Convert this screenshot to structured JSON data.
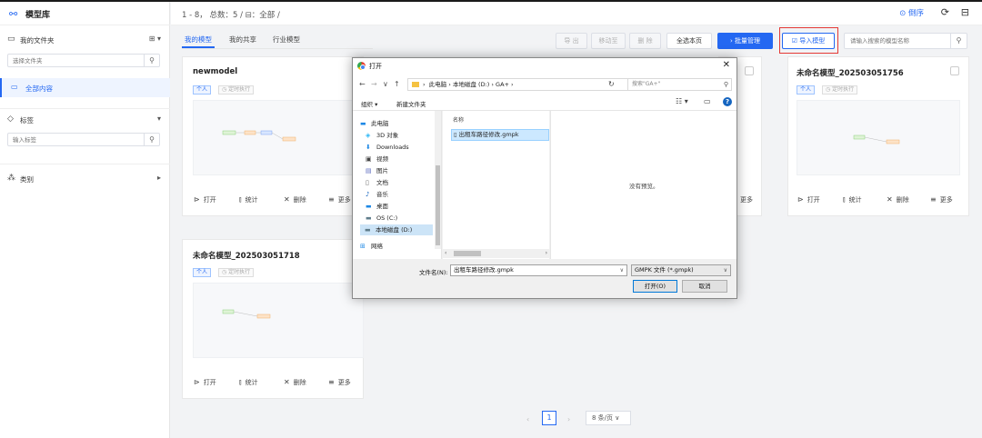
{
  "app": {
    "title": "模型库"
  },
  "sidebar": {
    "folder_label": "我的文件夹",
    "folder_search_placeholder": "选择文件夹",
    "all_content": "全部内容",
    "tags_label": "标签",
    "tags_placeholder": "输入标签",
    "category_label": "类别"
  },
  "header": {
    "breadcrumb": "1 - 8， 总数：5  /  ⊟：全部  /",
    "sort_label": "倒序"
  },
  "tabs": [
    "我的模型",
    "我的共享",
    "行业模型"
  ],
  "toolbar": {
    "export": "导 出",
    "move": "移动至",
    "delete": "删 除",
    "select_page": "全选本页",
    "batch_manage": "› 批量管理",
    "import_model": "导入模型",
    "search_placeholder": "请输入搜索的模型名称"
  },
  "cards": [
    {
      "title": "newmodel",
      "tag_personal": "个人",
      "tag_schedule": "◷ 定时执行"
    },
    {
      "title": "未命名模型_202503051756",
      "tag_personal": "个人",
      "tag_schedule": "◷ 定时执行"
    },
    {
      "title": "未命名模型_202503051718",
      "tag_personal": "个人",
      "tag_schedule": "◷ 定时执行"
    }
  ],
  "card_actions": {
    "open": "打开",
    "stats": "统计",
    "delete": "删除",
    "more": "更多"
  },
  "card_actions_partial_more": "更多",
  "pagination": {
    "page": "1",
    "page_size": "8 条/页"
  },
  "dialog": {
    "title": "打开",
    "path": [
      "此电脑",
      "本地磁盘 (D:)",
      "GA+"
    ],
    "search_placeholder": "搜索\"GA+\"",
    "organize": "组织 ▾",
    "new_folder": "新建文件夹",
    "tree": [
      "此电脑",
      "3D 对象",
      "Downloads",
      "视频",
      "图片",
      "文档",
      "音乐",
      "桌面",
      "OS (C:)",
      "本地磁盘 (D:)",
      "网络"
    ],
    "column_name": "名称",
    "file_name": "出租车路径修改.gmpk",
    "no_preview": "没有预览。",
    "filename_label": "文件名(N):",
    "filename_value": "出租车路径修改.gmpk",
    "filetype": "GMPK 文件 (*.gmpk)",
    "open_btn": "打开(O)",
    "cancel_btn": "取消"
  },
  "colors": {
    "accent": "#2468f2",
    "highlight": "#e53935"
  }
}
